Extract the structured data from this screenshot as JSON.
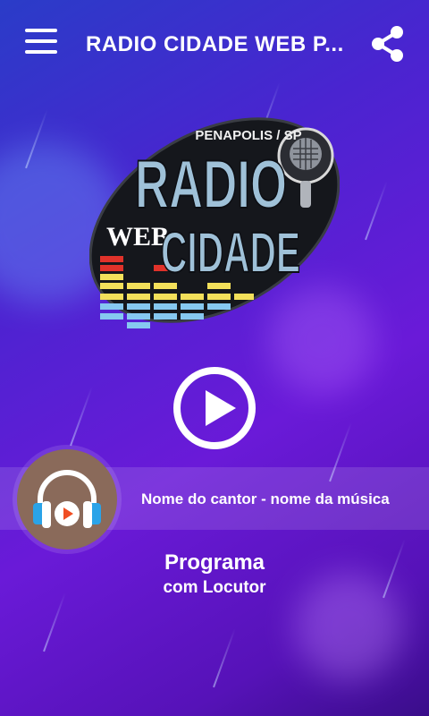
{
  "appbar": {
    "title": "RADIO CIDADE WEB P...",
    "menu_icon": "hamburger-menu-icon",
    "share_icon": "share-icon"
  },
  "logo": {
    "top_text": "PENAPOLIS / SP",
    "line1": "RADIO",
    "web": "WEB",
    "line2": "CIDADE"
  },
  "player": {
    "play_icon": "play-icon",
    "now_playing": "Nome do cantor - nome da música",
    "program_title": "Programa",
    "program_subtitle": "com Locutor",
    "avatar_icon": "headphones-icon"
  },
  "colors": {
    "accent_bg": "#5a1fd0",
    "avatar_bg": "#8a6a5a",
    "headphone_blue": "#2aa3e8",
    "play_orange": "#f04e23"
  }
}
